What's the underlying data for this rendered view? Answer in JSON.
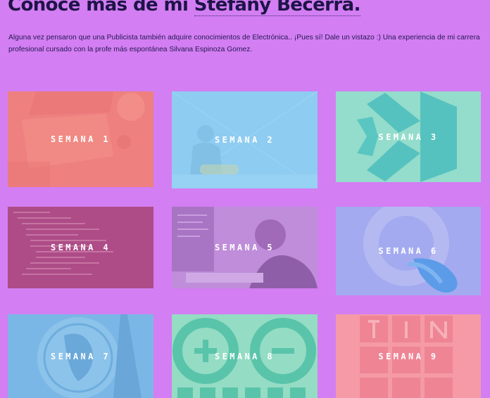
{
  "header": {
    "title_prefix": "Conoce más de mi ",
    "title_name": "Stefany Becerra.",
    "intro": "Alguna vez pensaron que una Publicista también adquire conocimientos de Electrónica.. ¡Pues sí! Dale un vistazo :) Una experiencia de mi carrera profesional cursado con la profe más espontánea Silvana Espinoza Gomez."
  },
  "cards": [
    {
      "label": "SEMANA 1",
      "icon": "desk-laptop-photo",
      "tint": "#f28a8a"
    },
    {
      "label": "SEMANA 2",
      "icon": "birthday-girl-photo",
      "tint": "#8ecdf2"
    },
    {
      "label": "SEMANA 3",
      "icon": "vscode-logo",
      "tint": "#94dccb"
    },
    {
      "label": "SEMANA 4",
      "icon": "code-screen-photo",
      "tint": "#b14d88"
    },
    {
      "label": "SEMANA 5",
      "icon": "woman-at-laptop-photo",
      "tint": "#bc8ad8"
    },
    {
      "label": "SEMANA 6",
      "icon": "3d-torus-shape",
      "tint": "#a0a8ef"
    },
    {
      "label": "SEMANA 7",
      "icon": "coin-statue-photo",
      "tint": "#7ab8e6"
    },
    {
      "label": "SEMANA 8",
      "icon": "arduino-logo",
      "tint": "#94dcc4"
    },
    {
      "label": "SEMANA 9",
      "icon": "tinkercad-logo",
      "tint": "#f59aa6"
    }
  ]
}
